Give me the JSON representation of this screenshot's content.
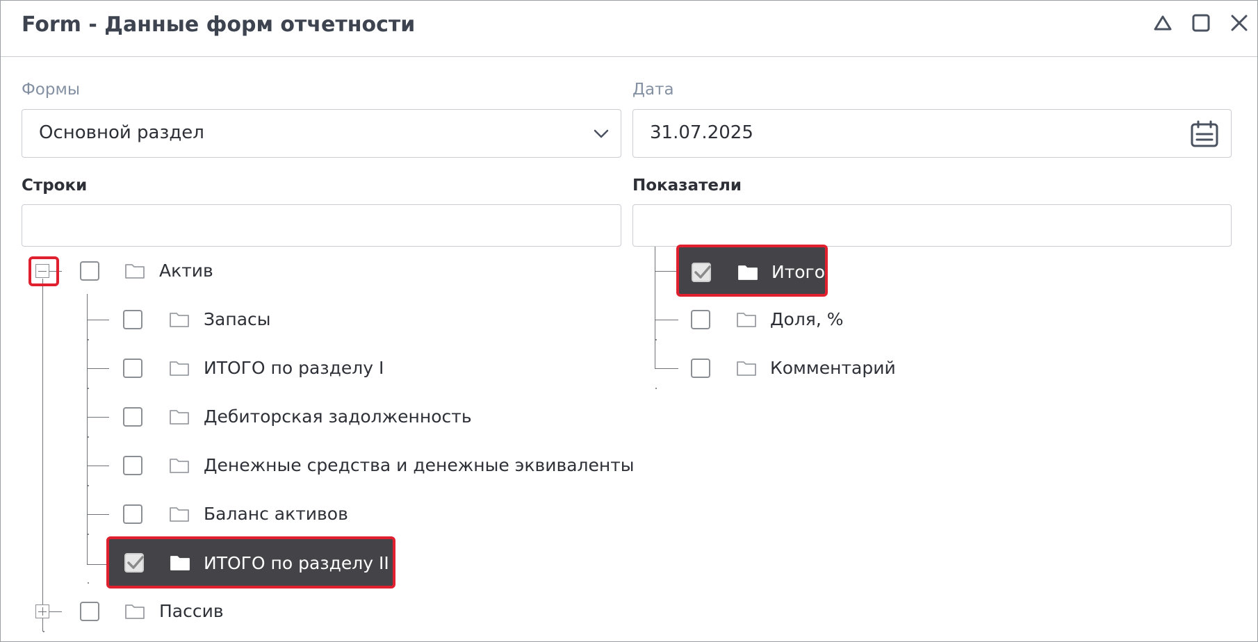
{
  "window": {
    "title": "Form - Данные форм отчетности",
    "controls": [
      "collapse-icon",
      "maximize-icon",
      "close-icon"
    ]
  },
  "forms": {
    "label": "Формы",
    "value": "Основной раздел"
  },
  "date": {
    "label": "Дата",
    "value": "31.07.2025"
  },
  "rows": {
    "label": "Строки",
    "filter_value": "",
    "tree": {
      "root_active": {
        "label": "Актив",
        "expanded": true,
        "children": [
          {
            "label": "Запасы",
            "checked": false
          },
          {
            "label": "ИТОГО по разделу I",
            "checked": false
          },
          {
            "label": "Дебиторская задолженность",
            "checked": false
          },
          {
            "label": "Денежные средства и денежные эквиваленты",
            "checked": false
          },
          {
            "label": "Баланс активов",
            "checked": false
          },
          {
            "label": "ИТОГО по разделу II",
            "checked": true
          }
        ]
      },
      "root_passive": {
        "label": "Пассив",
        "expanded": false
      }
    }
  },
  "indicators": {
    "label": "Показатели",
    "filter_value": "",
    "items": [
      {
        "label": "Итого",
        "checked": true
      },
      {
        "label": "Доля, %",
        "checked": false
      },
      {
        "label": "Комментарий",
        "checked": false
      }
    ]
  },
  "colors": {
    "highlight": "#e0202f",
    "selected_bg": "#444448",
    "label_muted": "#8491a3"
  }
}
